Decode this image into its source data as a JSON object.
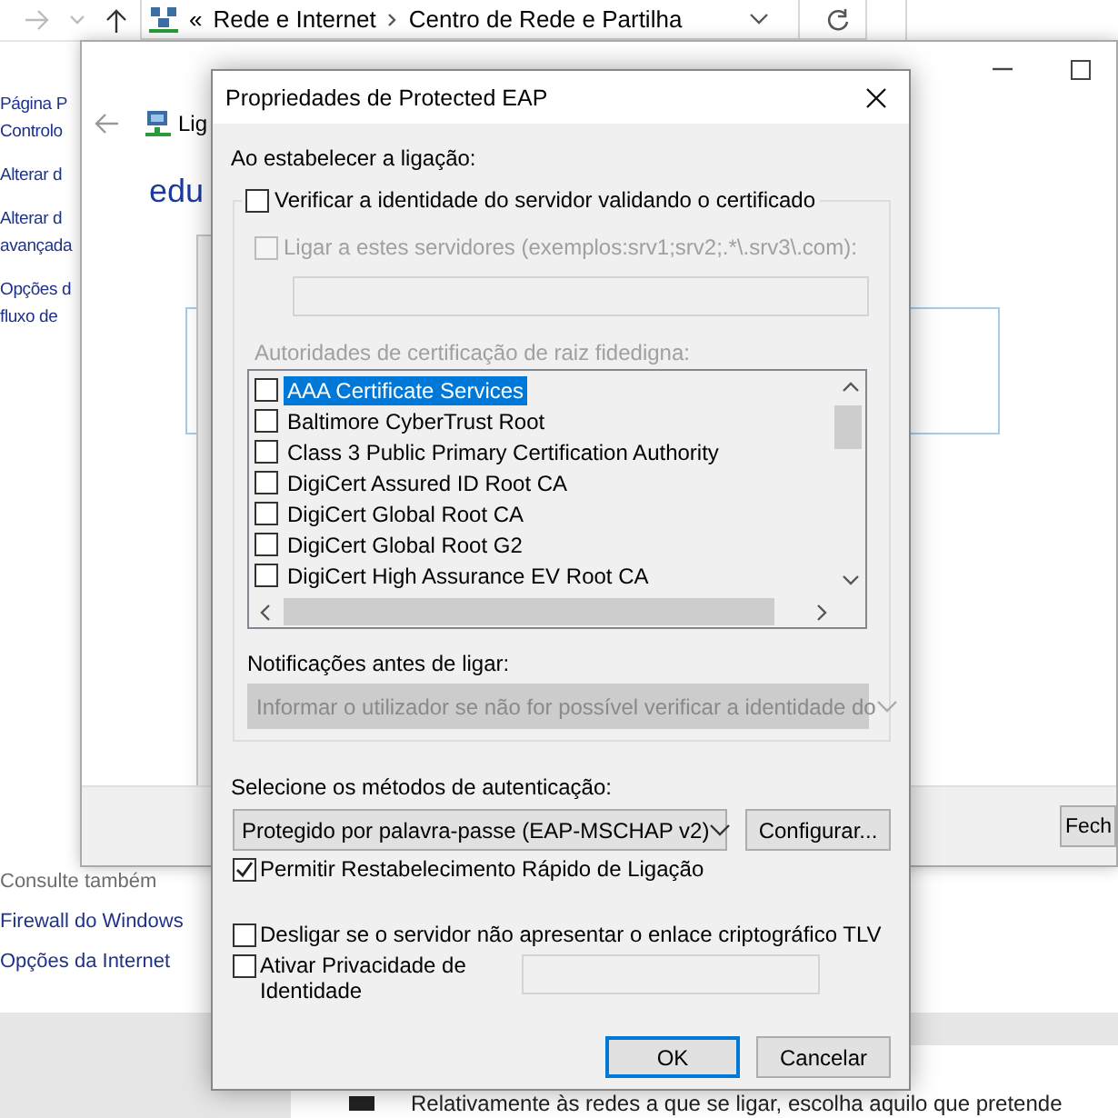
{
  "explorer": {
    "address_bar": {
      "overflow": "«",
      "path": [
        "Rede e Internet",
        "Centro de Rede e Partilha"
      ]
    },
    "sidebar": [
      {
        "lines": [
          "Página P",
          "Controlo"
        ]
      },
      {
        "lines": [
          "Alterar d"
        ]
      },
      {
        "lines": [
          "Alterar d",
          "avançada"
        ]
      },
      {
        "lines": [
          "Opções d",
          "fluxo de"
        ]
      }
    ],
    "see_also": {
      "title": "Consulte também",
      "links": [
        "Firewall do Windows",
        "Opções da Internet"
      ]
    },
    "bottom_text": "Relativamente às redes a que se ligar, escolha aquilo que pretende"
  },
  "status_window": {
    "header_text": "Lig",
    "network_name": "edu",
    "buttons": [
      "Fech"
    ]
  },
  "dialog": {
    "title": "Propriedades de Protected EAP",
    "section_label": "Ao estabelecer a ligação:",
    "verify_server": {
      "label": "Verificar a identidade do servidor validando o certificado",
      "checked": false
    },
    "connect_servers": {
      "label": "Ligar a estes servidores (exemplos:srv1;srv2;.*\\.srv3\\.com):",
      "checked": false,
      "disabled": true
    },
    "ca_label": "Autoridades de certificação de raiz fidedigna:",
    "ca_list": [
      {
        "label": "AAA Certificate Services",
        "checked": false,
        "selected": true
      },
      {
        "label": "Baltimore CyberTrust Root",
        "checked": false,
        "selected": false
      },
      {
        "label": "Class 3 Public Primary Certification Authority",
        "checked": false,
        "selected": false
      },
      {
        "label": "DigiCert Assured ID Root CA",
        "checked": false,
        "selected": false
      },
      {
        "label": "DigiCert Global Root CA",
        "checked": false,
        "selected": false
      },
      {
        "label": "DigiCert Global Root G2",
        "checked": false,
        "selected": false
      },
      {
        "label": "DigiCert High Assurance EV Root CA",
        "checked": false,
        "selected": false
      }
    ],
    "notifications": {
      "label": "Notificações antes de ligar:",
      "value": "Informar o utilizador se não for possível verificar a identidade do",
      "disabled": true
    },
    "auth": {
      "label": "Selecione os métodos de autenticação:",
      "value": "Protegido por palavra-passe (EAP-MSCHAP v2)",
      "configure_button": "Configurar..."
    },
    "options": [
      {
        "kind": "plain",
        "label": "Permitir Restabelecimento Rápido de Ligação",
        "checked": true
      },
      {
        "kind": "plain",
        "label": "Desligar se o servidor não apresentar o enlace criptográfico TLV",
        "checked": false
      },
      {
        "kind": "field",
        "label": "Ativar Privacidade de Identidade",
        "checked": false
      }
    ],
    "buttons": [
      {
        "label": "OK",
        "default": true
      },
      {
        "label": "Cancelar",
        "default": false
      }
    ]
  }
}
